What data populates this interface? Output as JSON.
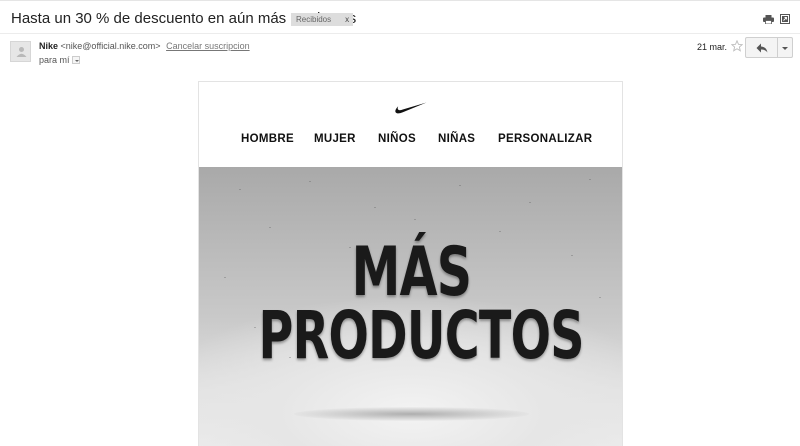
{
  "email": {
    "subject": "Hasta un 30 % de descuento en aún más productos",
    "label": "Recibidos",
    "label_remove": "x",
    "sender_name": "Nike",
    "sender_email": "<nike@official.nike.com>",
    "unsubscribe": "Cancelar suscripcion",
    "to": "para mí",
    "date": "21 mar."
  },
  "toolbar_icons": [
    "print-icon",
    "new-window-icon",
    "star-icon",
    "reply-icon",
    "more-icon"
  ],
  "content": {
    "logo": "nike-swoosh",
    "nav": [
      "HOMBRE",
      "MUJER",
      "NIÑOS",
      "NIÑAS",
      "PERSONALIZAR"
    ],
    "hero_line1": "MÁS",
    "hero_line2": "PRODUCTOS"
  },
  "colors": {
    "label_chip": "#dddddd",
    "hero_text": "#1a1a1a",
    "hero_background": "#b5b5b5"
  }
}
